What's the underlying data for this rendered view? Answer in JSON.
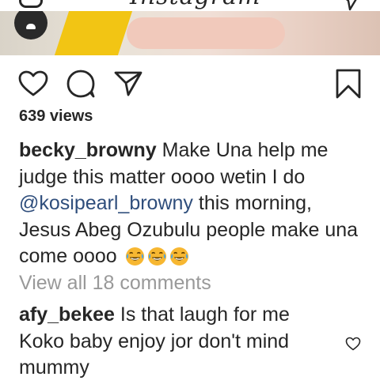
{
  "header": {
    "logo_text": "Instagram",
    "camera_icon": "camera-icon",
    "direct_icon": "paper-plane-icon"
  },
  "post": {
    "actions": {
      "like_icon": "heart-icon",
      "comment_icon": "comment-bubble-icon",
      "share_icon": "paper-plane-icon",
      "save_icon": "bookmark-icon"
    },
    "views": "639 views",
    "caption": {
      "username": "becky_browny",
      "text_part1": " Make Una help me judge this matter oooo wetin I do ",
      "mention": "@kosipearl_browny",
      "text_part2": " this morning, Jesus Abeg Ozubulu people make una come oooo",
      "emojis": [
        "face-with-tears-of-joy",
        "face-with-tears-of-joy",
        "face-with-tears-of-joy"
      ]
    },
    "view_all_comments": "View all 18 comments",
    "comments": [
      {
        "username": "afy_bekee",
        "text": " Is that laugh for me Koko baby enjoy jor don't mind mummy",
        "like_icon": "heart-outline-icon"
      }
    ]
  },
  "colors": {
    "text": "#262626",
    "muted": "#999999",
    "mention": "#2f4e7c"
  }
}
